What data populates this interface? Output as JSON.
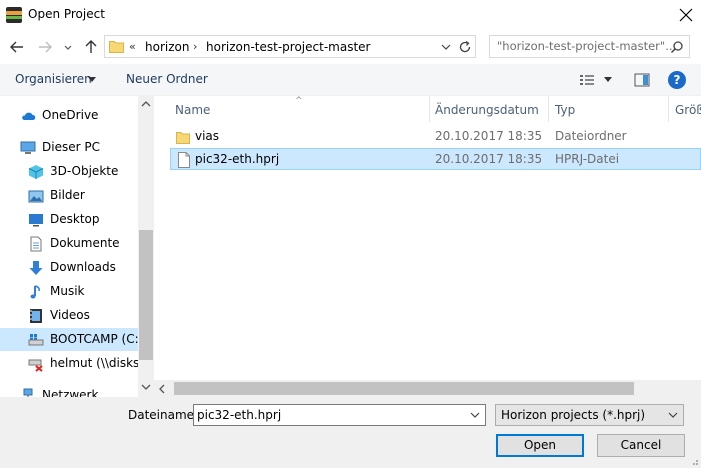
{
  "window": {
    "title": "Open Project"
  },
  "address": {
    "overflow": "«",
    "segments": [
      "horizon",
      "horizon-test-project-master"
    ],
    "search_placeholder": "\"horizon-test-project-master\"..."
  },
  "toolbar": {
    "organize": "Organisieren",
    "new_folder": "Neuer Ordner",
    "help": "?"
  },
  "nav": {
    "items": [
      {
        "label": "OneDrive",
        "icon": "cloud-icon"
      },
      {
        "label": "Dieser PC",
        "icon": "computer-icon"
      },
      {
        "label": "3D-Objekte",
        "icon": "cube-icon"
      },
      {
        "label": "Bilder",
        "icon": "pictures-icon"
      },
      {
        "label": "Desktop",
        "icon": "desktop-icon"
      },
      {
        "label": "Dokumente",
        "icon": "documents-icon"
      },
      {
        "label": "Downloads",
        "icon": "download-icon"
      },
      {
        "label": "Musik",
        "icon": "music-icon"
      },
      {
        "label": "Videos",
        "icon": "video-icon"
      },
      {
        "label": "BOOTCAMP (C:)",
        "icon": "drive-icon"
      },
      {
        "label": "helmut (\\\\diskst",
        "icon": "network-drive-icon"
      },
      {
        "label": "Netzwerk",
        "icon": "network-icon"
      }
    ]
  },
  "files": {
    "columns": [
      "Name",
      "Änderungsdatum",
      "Typ",
      "Größ"
    ],
    "rows": [
      {
        "name": "vias",
        "date": "20.10.2017 18:35",
        "type": "Dateiordner",
        "icon": "folder-icon"
      },
      {
        "name": "pic32-eth.hprj",
        "date": "20.10.2017 18:35",
        "type": "HPRJ-Datei",
        "icon": "file-icon"
      }
    ]
  },
  "bottom": {
    "filename_label": "Dateiname:",
    "filename_value": "pic32-eth.hprj",
    "filter_value": "Horizon projects (*.hprj)",
    "open_label": "Open",
    "cancel_label": "Cancel"
  },
  "colors": {
    "selection": "#cce8ff",
    "selection_border": "#99d1ff",
    "accent": "#0078d7"
  }
}
